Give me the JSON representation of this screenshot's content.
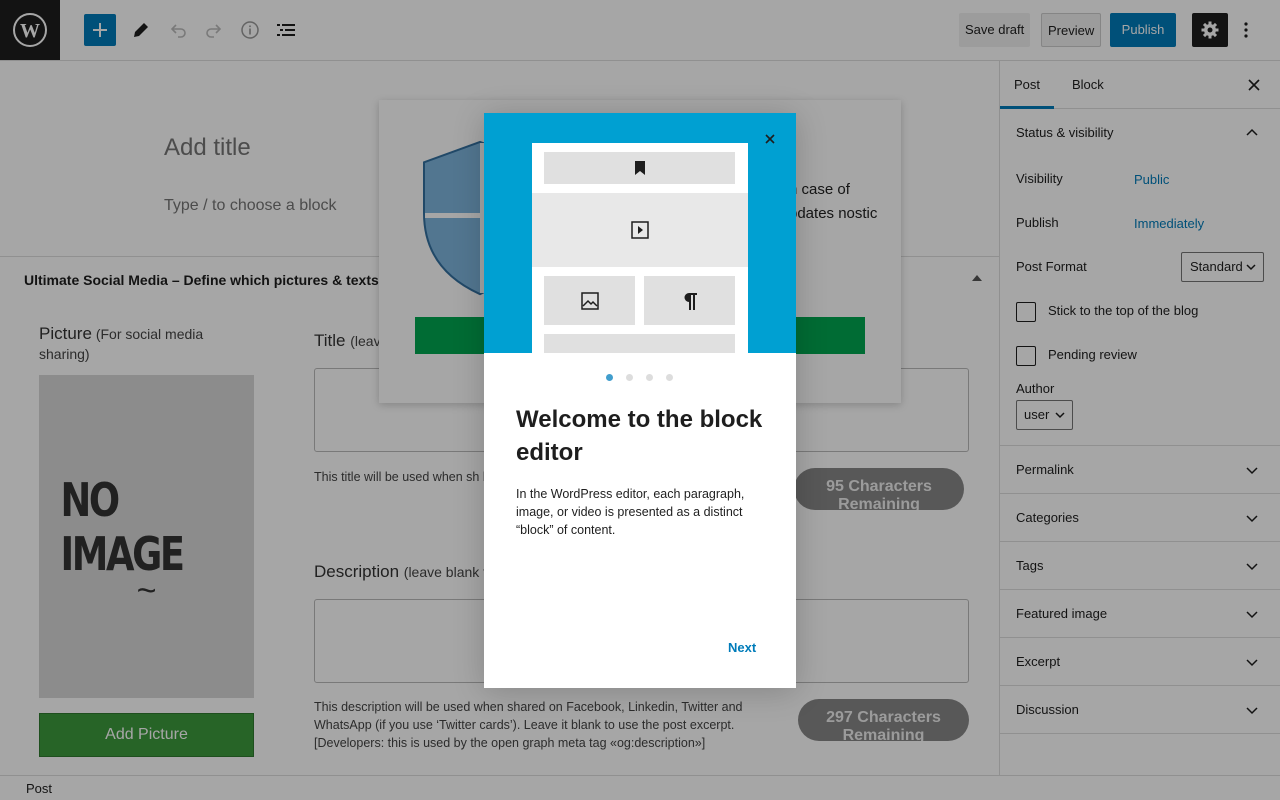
{
  "toolbar": {
    "save_draft": "Save draft",
    "preview": "Preview",
    "publish": "Publish"
  },
  "editor": {
    "title_placeholder": "Add title",
    "block_placeholder": "Type / to choose a block"
  },
  "metabox": {
    "title": "Ultimate Social Media – Define which pictures & texts will g",
    "picture_label": "Picture",
    "picture_note": "(For social media sharing)",
    "no_image_text": "NO IMAGE",
    "no_image_tilde": "~",
    "add_picture": "Add Picture",
    "title_label": "Title",
    "title_note": "(leav",
    "title_help": "This title will be used when sh blank to use the post title. [Dev «og:title»]",
    "title_count": "95 Characters Remaining",
    "description_label": "Description",
    "description_note": "(leave blank t",
    "description_help": "This description will be used when shared on Facebook, Linkedin, Twitter and WhatsApp (if you use ‘Twitter cards’). Leave it blank to use the post excerpt. [Developers: this is used by the open graph meta tag «og:description»]",
    "description_count": "297 Characters Remaining"
  },
  "notice": {
    "text": "n case of pdates nostic"
  },
  "sidebar": {
    "tab_post": "Post",
    "tab_block": "Block",
    "status_title": "Status & visibility",
    "visibility_label": "Visibility",
    "visibility_value": "Public",
    "publish_label": "Publish",
    "publish_value": "Immediately",
    "format_label": "Post Format",
    "format_value": "Standard",
    "sticky_label": "Stick to the top of the blog",
    "pending_label": "Pending review",
    "author_label": "Author",
    "author_value": "user",
    "panels": [
      "Permalink",
      "Categories",
      "Tags",
      "Featured image",
      "Excerpt",
      "Discussion"
    ]
  },
  "footer": {
    "label": "Post"
  },
  "guide": {
    "heading": "Welcome to the block editor",
    "body": "In the WordPress editor, each paragraph, image, or video is presented as a distinct “block” of content.",
    "next": "Next",
    "hero_icons": [
      "bookmark-icon",
      "video-icon",
      "image-icon",
      "paragraph-icon"
    ],
    "current_page": 1,
    "page_count": 4
  },
  "colors": {
    "accent": "#007cba",
    "hero_bg": "#00a0d2",
    "add_picture_bg": "#3d9a3d",
    "notice_button": "#00a650"
  }
}
